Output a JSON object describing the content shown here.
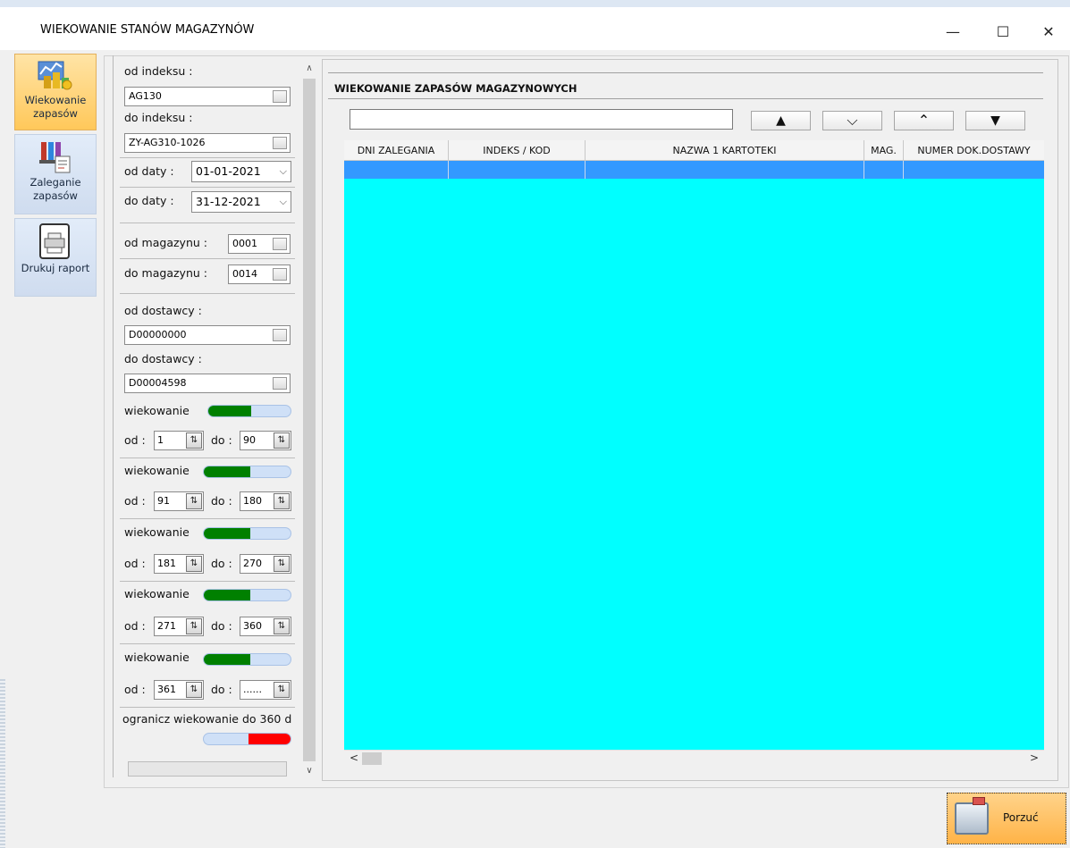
{
  "window": {
    "title": "WIEKOWANIE STANÓW MAGAZYNÓW",
    "minimize": "—",
    "maximize": "☐",
    "close": "✕"
  },
  "toolbar": {
    "items": [
      {
        "label": "Wiekowanie zapasów",
        "icon": "stock-aging-icon",
        "active": true
      },
      {
        "label": "Zaleganie zapasów",
        "icon": "stock-report-icon",
        "active": false
      },
      {
        "label": "Drukuj raport",
        "icon": "printer-icon",
        "active": false
      }
    ]
  },
  "filters": {
    "od_indeksu_label": "od indeksu :",
    "od_indeksu_value": "AG130",
    "do_indeksu_label": "do indeksu :",
    "do_indeksu_value": "ZY-AG310-1026",
    "od_daty_label": "od daty :",
    "od_daty_value": "01-01-2021",
    "do_daty_label": "do daty :",
    "do_daty_value": "31-12-2021",
    "od_magazynu_label": "od magazynu :",
    "od_magazynu_value": "0001",
    "do_magazynu_label": "do magazynu :",
    "do_magazynu_value": "0014",
    "od_dostawcy_label": "od dostawcy :",
    "od_dostawcy_value": "D00000000",
    "do_dostawcy_label": "do dostawcy :",
    "do_dostawcy_value": "D00004598",
    "aging_label": "wiekowanie",
    "od_label": "od :",
    "do_label": "do :",
    "aging_ranges": [
      {
        "from": "1",
        "to": "90"
      },
      {
        "from": "91",
        "to": "180"
      },
      {
        "from": "181",
        "to": "270"
      },
      {
        "from": "271",
        "to": "360"
      },
      {
        "from": "361",
        "to": "......"
      }
    ],
    "limit_label": "ogranicz wiekowanie do 360 d"
  },
  "grid": {
    "title": "WIEKOWANIE ZAPASÓW MAGAZYNOWYCH",
    "search_value": "",
    "nav": {
      "first": "▲",
      "next": "⌵",
      "prev": "⌃",
      "last": "▼"
    },
    "columns": [
      "DNI ZALEGANIA",
      "INDEKS / KOD",
      "NAZWA 1 KARTOTEKI",
      "MAG.",
      "NUMER DOK.DOSTAWY"
    ],
    "scroll_left": "<",
    "scroll_right": ">"
  },
  "footer": {
    "porzuc_label": "Porzuć"
  },
  "colors": {
    "grid_bg": "#00ffff",
    "selected_row": "#3399ff",
    "toggle_on": "#008000",
    "toggle_limit": "#ff0000",
    "active_tool": "#ffc85a"
  }
}
